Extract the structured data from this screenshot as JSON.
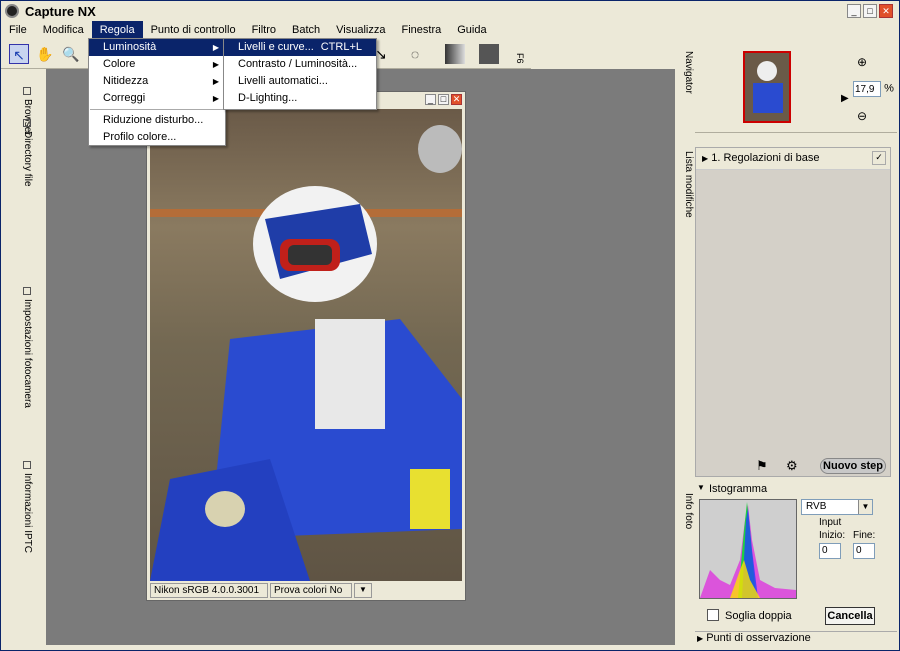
{
  "app": {
    "title": "Capture NX"
  },
  "menubar": [
    "File",
    "Modifica",
    "Regola",
    "Punto di controllo",
    "Filtro",
    "Batch",
    "Visualizza",
    "Finestra",
    "Guida"
  ],
  "regola_menu": [
    {
      "label": "Luminosità",
      "submenu": true,
      "highlight": true
    },
    {
      "label": "Colore",
      "submenu": true
    },
    {
      "label": "Nitidezza",
      "submenu": true
    },
    {
      "label": "Correggi",
      "submenu": true
    },
    {
      "label": "Riduzione disturbo..."
    },
    {
      "label": "Profilo colore..."
    }
  ],
  "luminosita_submenu": [
    {
      "label": "Livelli e curve...",
      "shortcut": "CTRL+L",
      "highlight": true
    },
    {
      "label": "Contrasto / Luminosità..."
    },
    {
      "label": "Livelli automatici..."
    },
    {
      "label": "D-Lighting..."
    }
  ],
  "toolbar": {
    "f6": "F6"
  },
  "left_tabs": [
    "Browser",
    "Directory file",
    "Impostazioni fotocamera",
    "Informazioni IPTC"
  ],
  "right_tabs": [
    "Navigator",
    "Lista modifiche",
    "Info foto"
  ],
  "navigator": {
    "zoom": "17,9",
    "unit": "%"
  },
  "lista": {
    "item": "1. Regolazioni di base",
    "new_step": "Nuovo step"
  },
  "istogramma": {
    "title": "Istogramma",
    "channel": "RVB",
    "input": "Input",
    "start_label": "Inizio:",
    "end_label": "Fine:",
    "start": "0",
    "end": "0",
    "double_threshold": "Soglia doppia",
    "cancel": "Cancella"
  },
  "punti": "Punti di osservazione",
  "image_window": {
    "profile": "Nikon sRGB 4.0.0.3001",
    "proof": "Prova colori No"
  }
}
